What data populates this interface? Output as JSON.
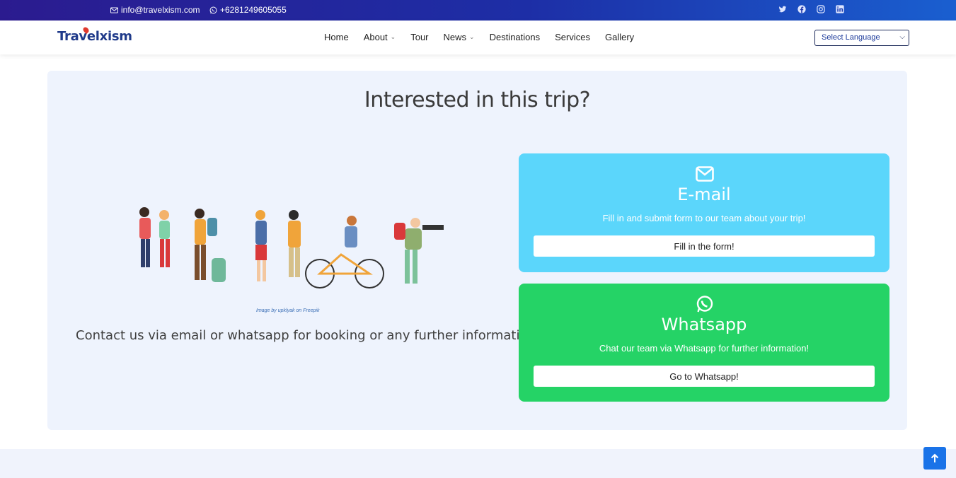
{
  "topbar": {
    "email": "info@travelxism.com",
    "phone": "+6281249605055",
    "socials": [
      "twitter-icon",
      "facebook-icon",
      "instagram-icon",
      "linkedin-icon"
    ]
  },
  "nav": {
    "logo": "Travelxism",
    "items": [
      {
        "label": "Home",
        "dropdown": false
      },
      {
        "label": "About",
        "dropdown": true
      },
      {
        "label": "Tour",
        "dropdown": false
      },
      {
        "label": "News",
        "dropdown": true
      },
      {
        "label": "Destinations",
        "dropdown": false
      },
      {
        "label": "Services",
        "dropdown": false
      },
      {
        "label": "Gallery",
        "dropdown": false
      }
    ],
    "language": "Select Language"
  },
  "main": {
    "title": "Interested in this trip?",
    "image_credit": "Image by upklyak on Freepik",
    "contact_text": "Contact us via email or whatsapp for booking or any further information",
    "email_card": {
      "title": "E-mail",
      "description": "Fill in and submit form to our team about your trip!",
      "button": "Fill in the form!",
      "color": "#5bd6fb"
    },
    "whatsapp_card": {
      "title": "Whatsapp",
      "description": "Chat our team via Whatsapp for further information!",
      "button": "Go to Whatsapp!",
      "color": "#25d366"
    }
  },
  "colors": {
    "topbar_start": "#2b1b8f",
    "topbar_end": "#1a5fd0",
    "card_bg": "#eef3fd",
    "accent": "#1a73e8"
  }
}
